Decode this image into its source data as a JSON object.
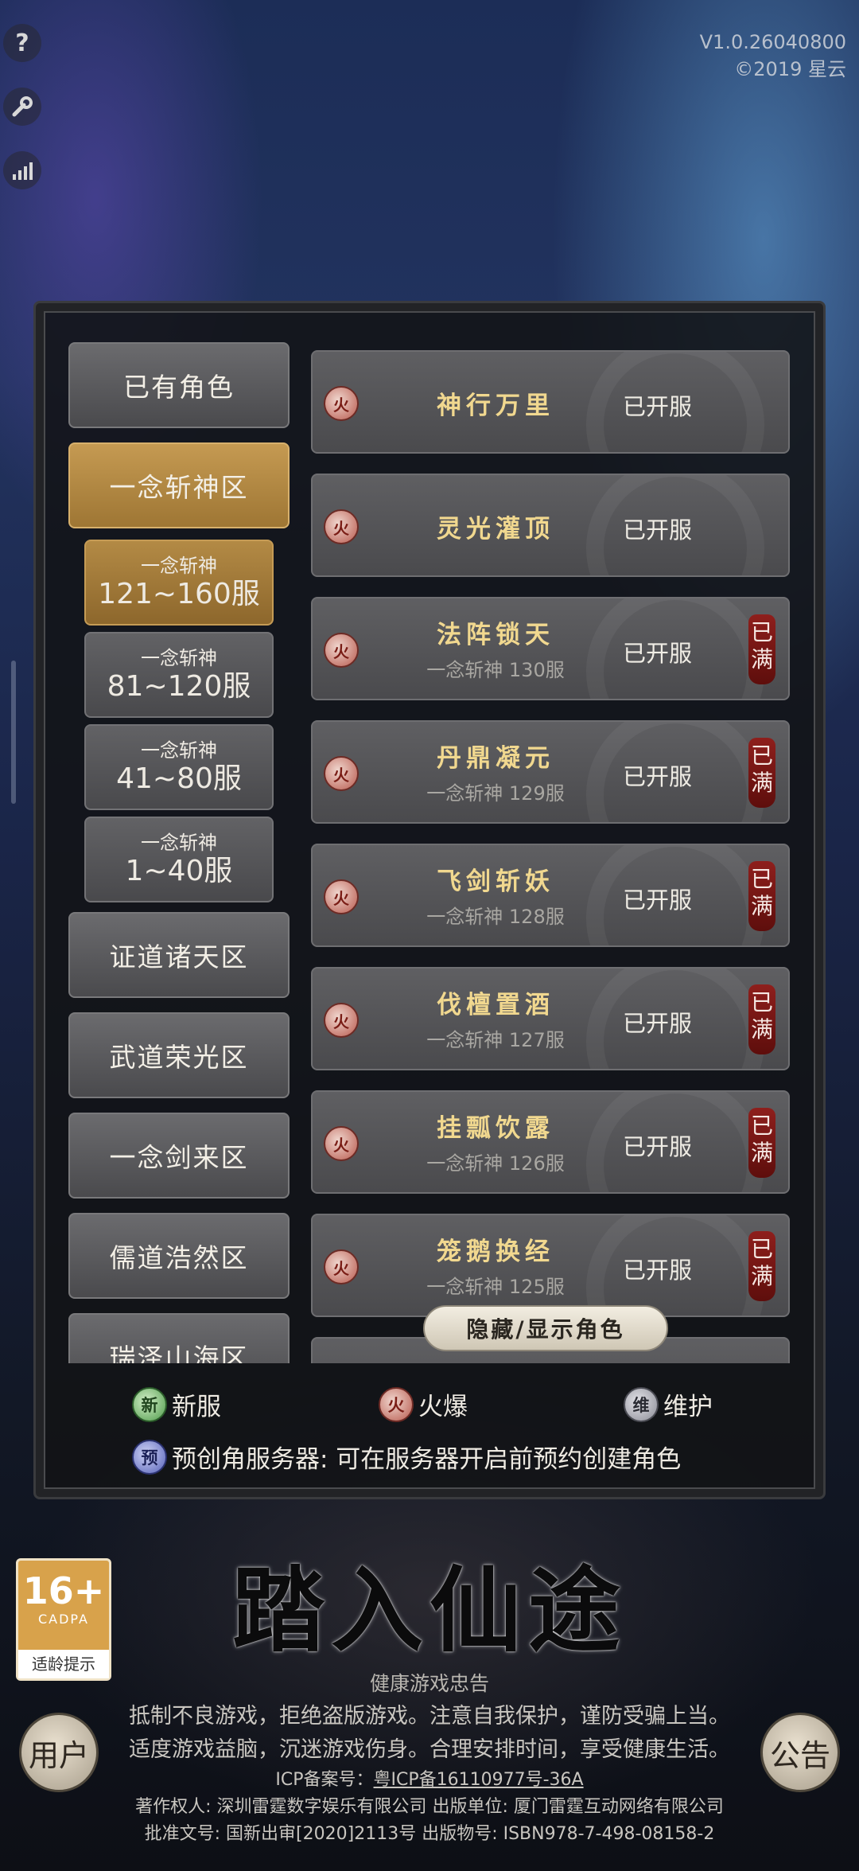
{
  "version": {
    "line1": "V1.0.26040800",
    "line2": "©2019 星云"
  },
  "zones": [
    {
      "label": "已有角色",
      "active": false
    },
    {
      "label": "一念斩神区",
      "active": true
    },
    {
      "label": "证道诸天区",
      "active": false
    },
    {
      "label": "武道荣光区",
      "active": false
    },
    {
      "label": "一念剑来区",
      "active": false
    },
    {
      "label": "儒道浩然区",
      "active": false
    },
    {
      "label": "瑞泽山海区",
      "active": false
    }
  ],
  "subzones": [
    {
      "line1": "一念斩神",
      "line2": "121~160服"
    },
    {
      "line1": "一念斩神",
      "line2": "81~120服"
    },
    {
      "line1": "一念斩神",
      "line2": "41~80服"
    },
    {
      "line1": "一念斩神",
      "line2": "1~40服"
    }
  ],
  "servers": [
    {
      "name": "神行万里",
      "sub": "",
      "status": "已开服",
      "full": ""
    },
    {
      "name": "灵光灌顶",
      "sub": "",
      "status": "已开服",
      "full": ""
    },
    {
      "name": "法阵锁天",
      "sub": "一念斩神 130服",
      "status": "已开服",
      "full": "已满"
    },
    {
      "name": "丹鼎凝元",
      "sub": "一念斩神 129服",
      "status": "已开服",
      "full": "已满"
    },
    {
      "name": "飞剑斩妖",
      "sub": "一念斩神 128服",
      "status": "已开服",
      "full": "已满"
    },
    {
      "name": "伐檀置酒",
      "sub": "一念斩神 127服",
      "status": "已开服",
      "full": "已满"
    },
    {
      "name": "挂瓢饮露",
      "sub": "一念斩神 126服",
      "status": "已开服",
      "full": "已满"
    },
    {
      "name": "笼鹅换经",
      "sub": "一念斩神 125服",
      "status": "已开服",
      "full": "已满"
    }
  ],
  "hot_icon_char": "火",
  "toggle_label": "隐藏/显示角色",
  "legend": {
    "new_icon": "新",
    "new_label": "新服",
    "hot_icon": "火",
    "hot_label": "火爆",
    "maint_icon": "维",
    "maint_label": "维护",
    "pre_icon": "预",
    "pre_label": "预创角服务器: 可在服务器开启前预约创建角色"
  },
  "slogan": "踏入仙途",
  "age_rating": {
    "num": "16+",
    "org": "CADPA",
    "tip": "适龄提示"
  },
  "left_button": "用户",
  "right_button": "公告",
  "footer": {
    "title": "健康游戏忠告",
    "line1": "抵制不良游戏，拒绝盗版游戏。注意自我保护，谨防受骗上当。",
    "line2": "适度游戏益脑，沉迷游戏伤身。合理安排时间，享受健康生活。",
    "icp_prefix": "ICP备案号：",
    "icp_link": "粤ICP备16110977号-36A",
    "copyright": "著作权人: 深圳雷霆数字娱乐有限公司 出版单位: 厦门雷霆互动网络有限公司",
    "approval": "批准文号: 国新出审[2020]2113号 出版物号: ISBN978-7-498-08158-2"
  },
  "icons": {
    "help": "help-icon",
    "settings": "wrench-icon",
    "network": "signal-icon"
  }
}
